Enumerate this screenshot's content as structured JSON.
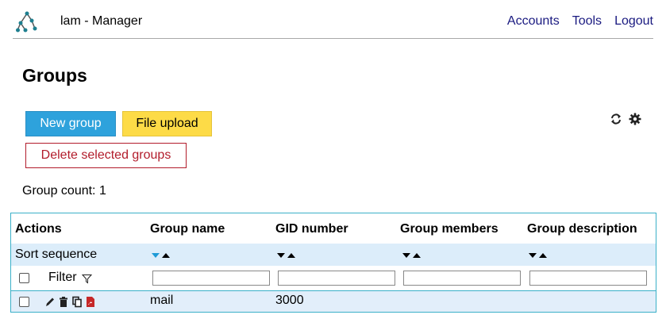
{
  "header": {
    "app_title": "lam - Manager",
    "nav": [
      "Accounts",
      "Tools",
      "Logout"
    ]
  },
  "page_title": "Groups",
  "buttons": {
    "new_group": "New group",
    "file_upload": "File upload",
    "delete_selected": "Delete selected groups"
  },
  "group_count": "Group count: 1",
  "table": {
    "columns": [
      "Actions",
      "Group name",
      "GID number",
      "Group members",
      "Group description"
    ],
    "sort_label": "Sort sequence",
    "filter_label": "Filter",
    "rows": [
      {
        "group_name": "mail",
        "gid_number": "3000",
        "group_members": "",
        "group_description": ""
      }
    ]
  },
  "colors": {
    "primary": "#2ea2dc",
    "upload": "#fddb47",
    "danger": "#b21c2b",
    "table_border": "#3ab0c8",
    "nav_link": "#1a1a80"
  }
}
